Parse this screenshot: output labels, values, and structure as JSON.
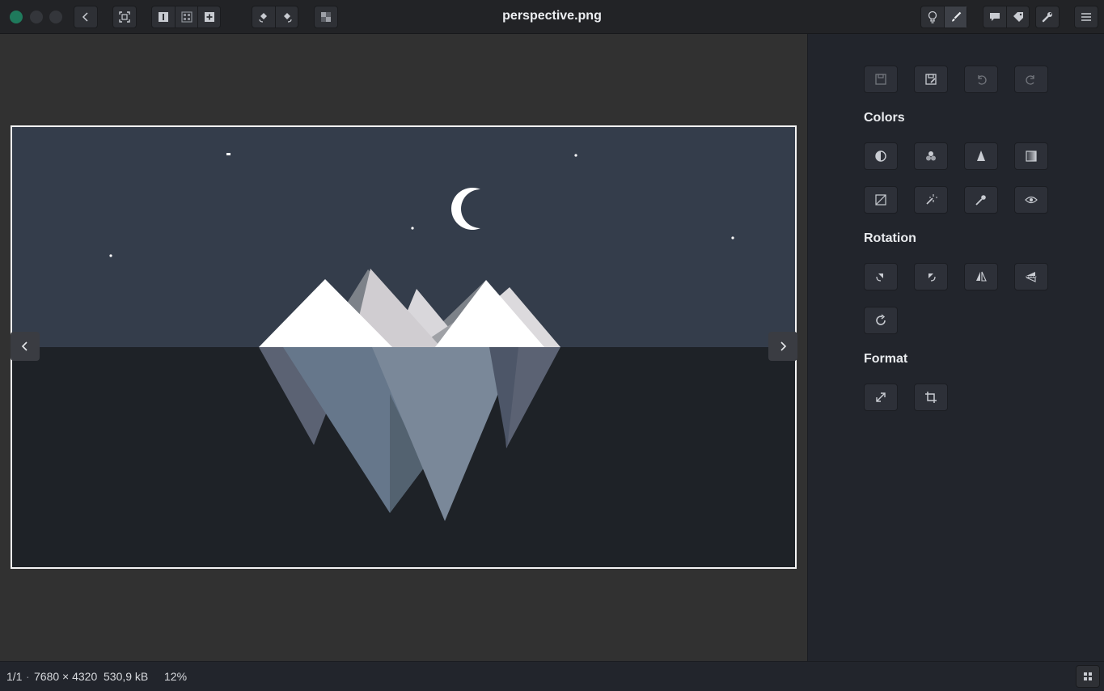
{
  "window": {
    "title": "perspective.png"
  },
  "header": {
    "buttons": [
      "window-close",
      "window-minimize",
      "window-maximize",
      "back",
      "fit-to-window",
      "single-view",
      "gallery-view",
      "add",
      "rotate-left",
      "rotate-right",
      "transparency",
      "lightbulb",
      "brush",
      "comment",
      "tag",
      "wrench",
      "menu"
    ]
  },
  "sidebar": {
    "toolbar": [
      "save",
      "save-as",
      "undo",
      "redo"
    ],
    "sections": {
      "colors": {
        "title": "Colors",
        "tools": [
          "contrast",
          "channels",
          "sharpen",
          "gradient",
          "curves",
          "magic",
          "eyedropper",
          "view"
        ]
      },
      "rotation": {
        "title": "Rotation",
        "tools": [
          "rotate-left",
          "rotate-right",
          "flip-horizontal",
          "flip-vertical",
          "rotate-free"
        ]
      },
      "format": {
        "title": "Format",
        "tools": [
          "resize",
          "crop"
        ]
      }
    }
  },
  "status": {
    "index": "1/1",
    "dimensions": "7680 × 4320",
    "filesize": "530,9 kB",
    "zoom": "12%"
  },
  "colors": {
    "sky": "#343d4b",
    "water": "#1e2227",
    "accent": "#1f7a5c"
  }
}
